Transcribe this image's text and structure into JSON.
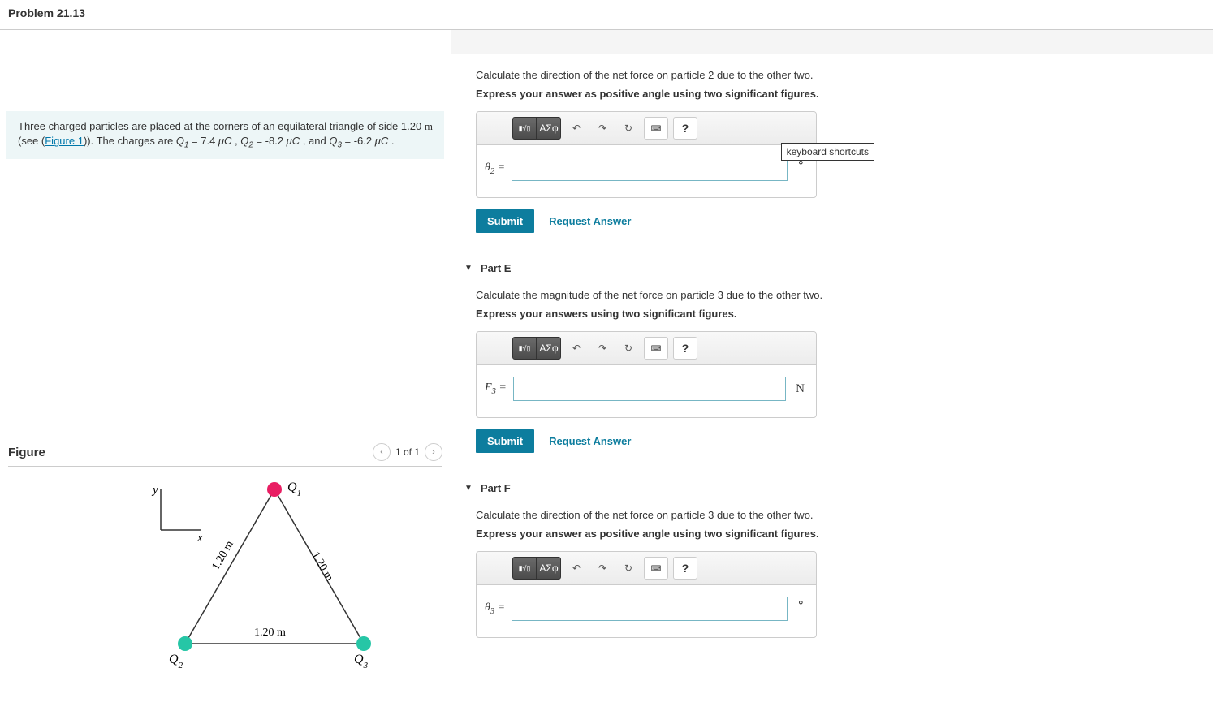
{
  "header": {
    "title": "Problem 21.13"
  },
  "problem": {
    "text_before": "Three charged particles are placed at the corners of an equilateral triangle of side 1.20 ",
    "unit1": "m",
    "text_mid": " (see (",
    "figure_link": "Figure 1",
    "text_after": ")). The charges are ",
    "q1var": "Q",
    "q1sub": "1",
    "q1eq": " = 7.4 ",
    "q1unit": "μC",
    "sep1": " , ",
    "q2var": "Q",
    "q2sub": "2",
    "q2eq": " = -8.2 ",
    "q2unit": "μC",
    "sep2": " , and ",
    "q3var": "Q",
    "q3sub": "3",
    "q3eq": " = -6.2 ",
    "q3unit": "μC",
    "end": " ."
  },
  "figure": {
    "title": "Figure",
    "pager": "1 of 1",
    "labels": {
      "y": "y",
      "x": "x",
      "q1": "Q",
      "q1s": "1",
      "q2": "Q",
      "q2s": "2",
      "q3": "Q",
      "q3s": "3",
      "side": "1.20 m"
    }
  },
  "toolbar": {
    "math_icon": "▮√▯",
    "greek": "ΑΣφ",
    "undo": "↶",
    "redo": "↷",
    "reset": "↻",
    "keyboard": "⌨",
    "help": "?",
    "tooltip": "keyboard shortcuts"
  },
  "parts": {
    "d": {
      "prompt": "Calculate the direction of the net force on particle 2 due to the other two.",
      "instr": "Express your answer as positive angle using two significant figures.",
      "var": "θ",
      "sub": "2",
      "eq": " = ",
      "unit": "∘",
      "submit": "Submit",
      "request": "Request Answer"
    },
    "e": {
      "title": "Part E",
      "prompt": "Calculate the magnitude of the net force on particle 3 due to the other two.",
      "instr": "Express your answers using two significant figures.",
      "var": "F",
      "sub": "3",
      "eq": " = ",
      "unit": "N",
      "submit": "Submit",
      "request": "Request Answer"
    },
    "f": {
      "title": "Part F",
      "prompt": "Calculate the direction of the net force on particle 3 due to the other two.",
      "instr": "Express your answer as positive angle using two significant figures.",
      "var": "θ",
      "sub": "3",
      "eq": " = ",
      "unit": "∘"
    }
  }
}
